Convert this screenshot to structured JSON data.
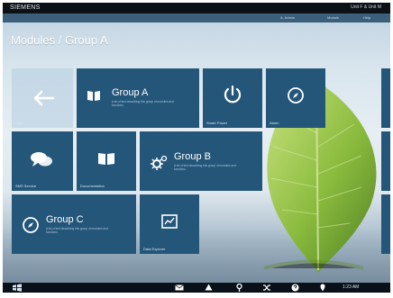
{
  "header": {
    "brand": "SIEMENS",
    "right_text": "Unit F & Unit M"
  },
  "subbar": {
    "items": [
      "A. Admin",
      "Module",
      "Help"
    ]
  },
  "page_title": "Modules / Group A",
  "tiles": [
    {
      "label": "Back",
      "icon": "arrow-left-icon"
    },
    {
      "title": "Group A",
      "icon": "book-icon",
      "description": "A lot of text describing this group of modules and functions."
    },
    {
      "label": "Smart Power",
      "icon": "power-icon"
    },
    {
      "label": "Alarm",
      "icon": "compass-icon"
    },
    {
      "label": "SMS Service",
      "icon": "chat-icon"
    },
    {
      "label": "Documentation",
      "icon": "book-icon"
    },
    {
      "title": "Group B",
      "icon": "gear-icon",
      "description": "A lot of text describing this group of modules and functions."
    },
    {
      "title": "Group C",
      "icon": "compass-icon",
      "description": "A lot of text describing this group of modules and functions."
    },
    {
      "label": "Data Explorer",
      "icon": "chart-icon"
    }
  ],
  "taskbar": {
    "icons": [
      "windows-icon",
      "mail-icon",
      "warning-icon",
      "pin-icon",
      "shuffle-icon",
      "help-icon",
      "location-icon"
    ],
    "clock": "1:23 AM"
  }
}
